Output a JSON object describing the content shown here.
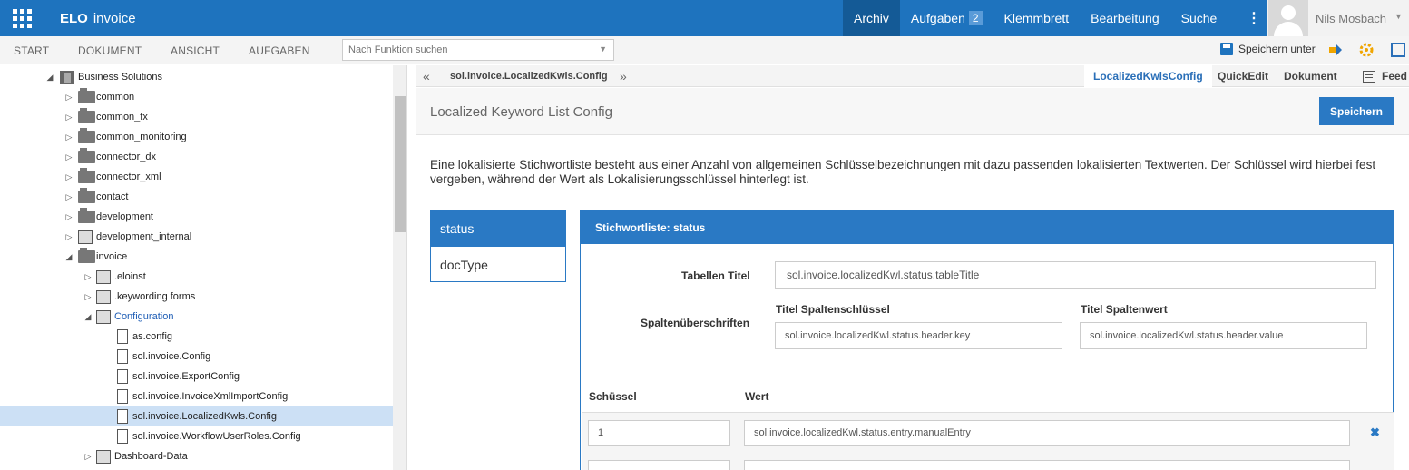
{
  "topbar": {
    "app_name_bold": "ELO",
    "app_name": "invoice",
    "nav": [
      {
        "label": "Archiv",
        "active": true
      },
      {
        "label": "Aufgaben",
        "badge": "2"
      },
      {
        "label": "Klemmbrett"
      },
      {
        "label": "Bearbeitung"
      },
      {
        "label": "Suche"
      }
    ],
    "more_icon": "⋮",
    "user_name": "Nils Mosbach",
    "user_caret": "▼"
  },
  "ribbon": {
    "tabs": [
      "START",
      "DOKUMENT",
      "ANSICHT",
      "AUFGABEN"
    ],
    "function_search_placeholder": "Nach Funktion suchen",
    "save_under_label": "Speichern unter",
    "colors": {
      "accent": "#1e73be",
      "button": "#2a79c4",
      "selection": "#cce0f5"
    }
  },
  "tree": {
    "rows": [
      {
        "label": "Business Solutions",
        "icon": "repository-icon",
        "toggle": "◢"
      },
      {
        "label": "common",
        "icon": "folder-icon",
        "toggle": "▷"
      },
      {
        "label": "common_fx",
        "icon": "folder-icon",
        "toggle": "▷"
      },
      {
        "label": "common_monitoring",
        "icon": "folder-icon",
        "toggle": "▷"
      },
      {
        "label": "connector_dx",
        "icon": "folder-icon",
        "toggle": "▷"
      },
      {
        "label": "connector_xml",
        "icon": "folder-icon",
        "toggle": "▷"
      },
      {
        "label": "contact",
        "icon": "folder-icon",
        "toggle": "▷"
      },
      {
        "label": "development",
        "icon": "folder-icon",
        "toggle": "▷"
      },
      {
        "label": "development_internal",
        "icon": "folder-icon",
        "toggle": "▷"
      },
      {
        "label": "invoice",
        "icon": "folder-icon",
        "toggle": "◢"
      },
      {
        "label": ".eloinst",
        "icon": "register-icon",
        "toggle": "▷"
      },
      {
        "label": ".keywording forms",
        "icon": "register-icon",
        "toggle": "▷"
      },
      {
        "label": "Configuration",
        "icon": "cabinet-icon",
        "toggle": "◢"
      },
      {
        "label": "as.config",
        "icon": "document-icon",
        "toggle": ""
      },
      {
        "label": "sol.invoice.Config",
        "icon": "document-icon",
        "toggle": ""
      },
      {
        "label": "sol.invoice.ExportConfig",
        "icon": "document-icon",
        "toggle": ""
      },
      {
        "label": "sol.invoice.InvoiceXmlImportConfig",
        "icon": "document-icon",
        "toggle": ""
      },
      {
        "label": "sol.invoice.LocalizedKwls.Config",
        "icon": "document-icon",
        "toggle": "",
        "selected": true
      },
      {
        "label": "sol.invoice.WorkflowUserRoles.Config",
        "icon": "document-icon",
        "toggle": ""
      },
      {
        "label": "Dashboard-Data",
        "icon": "cabinet-icon",
        "toggle": "▷"
      }
    ]
  },
  "viewer": {
    "breadcrumb": "sol.invoice.LocalizedKwls.Config",
    "back_icon": "«",
    "forward_icon": "»",
    "tabs": [
      {
        "label": "LocalizedKwlsConfig",
        "active": true
      },
      {
        "label": "QuickEdit"
      },
      {
        "label": "Dokument"
      },
      {
        "label": "Feed"
      }
    ]
  },
  "form": {
    "title": "Localized Keyword List Config",
    "save_button": "Speichern",
    "intro": "Eine lokalisierte Stichwortliste besteht aus einer Anzahl von allgemeinen Schlüsselbezeichnungen mit dazu passenden lokalisierten Textwerten. Der Schlüssel wird hierbei fest vergeben, während der Wert als Lokalisierungsschlüssel hinterlegt ist.",
    "lists": [
      "status",
      "docType"
    ],
    "panel": {
      "heading": "Stichwortliste: status",
      "table_title_label": "Tabellen Titel",
      "table_title_value": "sol.invoice.localizedKwl.status.tableTitle",
      "headers_label": "Spaltenüberschriften",
      "key_header_label": "Titel Spaltenschlüssel",
      "key_header_value": "sol.invoice.localizedKwl.status.header.key",
      "value_header_label": "Titel Spaltenwert",
      "value_header_value": "sol.invoice.localizedKwl.status.header.value",
      "col_key": "Schüssel",
      "col_value": "Wert",
      "entries": [
        {
          "key": "1",
          "value": "sol.invoice.localizedKwl.status.entry.manualEntry"
        }
      ],
      "delete_icon": "✖"
    }
  }
}
